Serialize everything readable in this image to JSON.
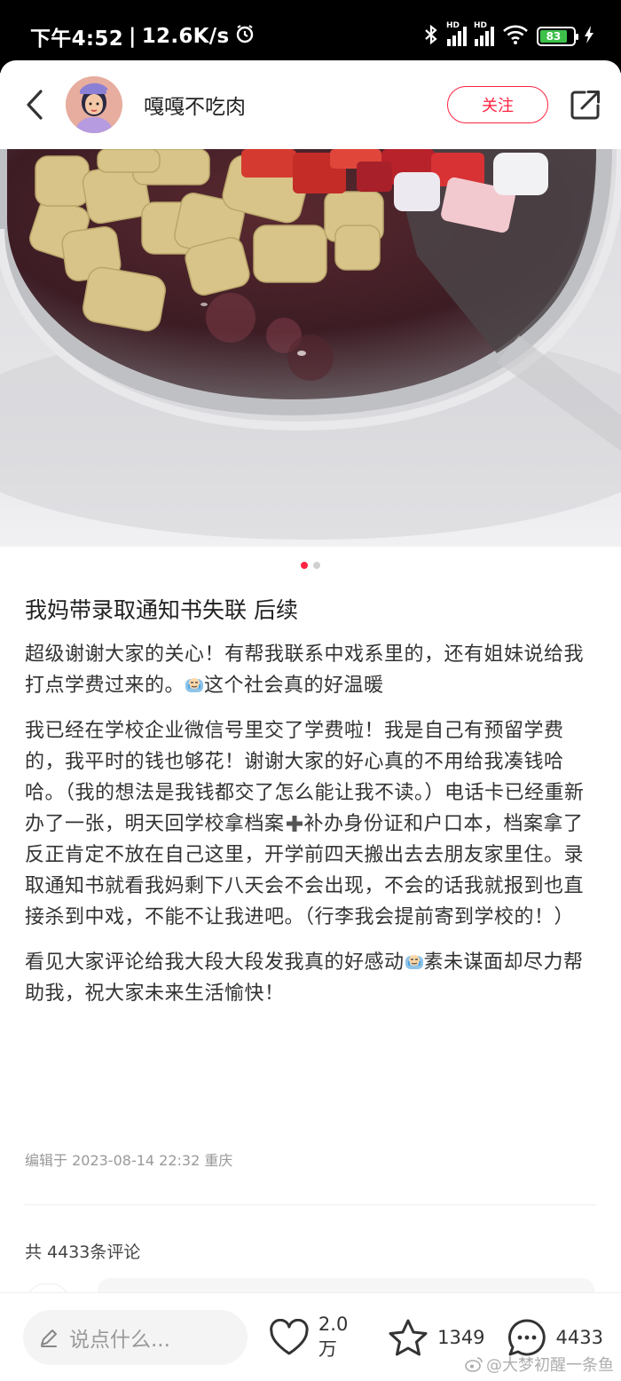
{
  "status_bar": {
    "time": "下午4:52",
    "separator": "|",
    "network_speed": "12.6K/s",
    "battery": "83",
    "icons": [
      "alarm-icon",
      "bluetooth-icon",
      "signal-hd-icon",
      "signal-hd-icon",
      "wifi-icon",
      "battery-icon",
      "charging-icon"
    ]
  },
  "header": {
    "author_name": "嘎嘎不吃肉",
    "follow_label": "关注"
  },
  "post": {
    "title": "我妈带录取通知书失联 后续",
    "paragraphs": [
      {
        "before": "超级谢谢大家的关心！有帮我联系中戏系里的，还有姐妹说给我打点学费过来的。",
        "after": "这个社会真的好温暖"
      },
      {
        "text": "我已经在学校企业微信号里交了学费啦！我是自己有预留学费的，我平时的钱也够花！谢谢大家的好心真的不用给我凑钱哈哈。（我的想法是我钱都交了怎么能让我不读。）电话卡已经重新办了一张，明天回学校拿档案"
      },
      {
        "before": "看见大家评论给我大段大段发我真的好感动",
        "after": "素未谋面却尽力帮助我，祝大家未来生活愉快！"
      }
    ],
    "para2_after_plus": "补办身份证和户口本，档案拿了反正肯定不放在自己这里，开学前四天搬出去去朋友家里住。录取通知书就看我妈剩下八天会不会出现，不会的话我就报到也直接杀到中戏，不能不让我进吧。（行李我会提前寄到学校的！）",
    "meta": "编辑于 2023-08-14 22:32 重庆",
    "comment_count_label": "共 4433条评论"
  },
  "bottom_bar": {
    "input_placeholder": "说点什么...",
    "likes": "2.0万",
    "collects": "1349",
    "comments": "4433"
  },
  "watermark": "@大梦初醒一条鱼"
}
